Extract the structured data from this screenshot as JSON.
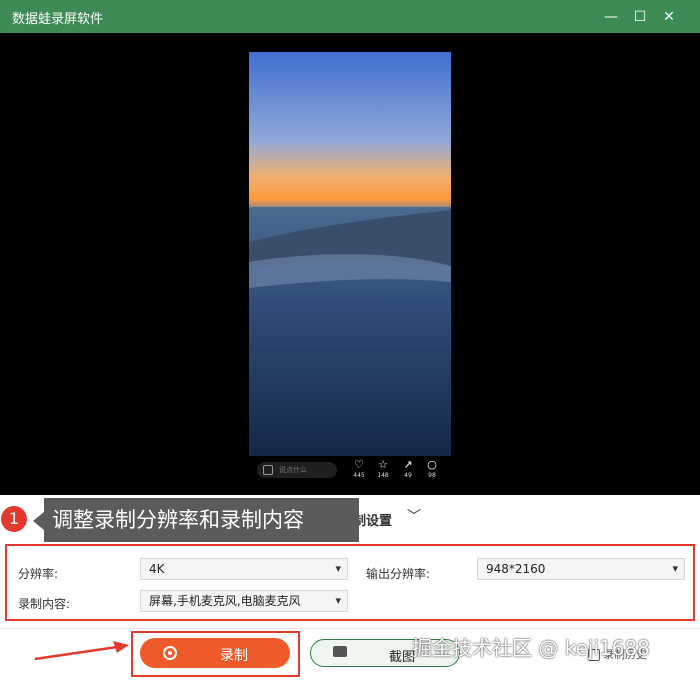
{
  "window": {
    "title": "数据蛙录屏软件"
  },
  "preview": {
    "comment_placeholder": "说点什么",
    "actions": [
      {
        "icon": "heart-icon",
        "glyph": "♡",
        "count": "445"
      },
      {
        "icon": "star-icon",
        "glyph": "☆",
        "count": "148"
      },
      {
        "icon": "share-icon",
        "glyph": "↗",
        "count": "49"
      },
      {
        "icon": "comment-icon",
        "glyph": "○",
        "count": "98"
      }
    ]
  },
  "annotation": {
    "number": "1",
    "text": "调整录制分辨率和录制内容"
  },
  "settings": {
    "title": "录制设置",
    "resolution_label": "分辨率:",
    "resolution_value": "4K",
    "output_label": "输出分辨率:",
    "output_value": "948*2160",
    "content_label": "录制内容:",
    "content_value": "屏幕,手机麦克风,电脑麦克风"
  },
  "buttons": {
    "record": "录制",
    "screenshot": "截图",
    "history": "录制历史"
  },
  "watermark": "掘金技术社区 @ keji1688",
  "colors": {
    "titlebar": "#3d8a55",
    "record": "#ef5a2a",
    "highlight": "#e23a2e"
  }
}
